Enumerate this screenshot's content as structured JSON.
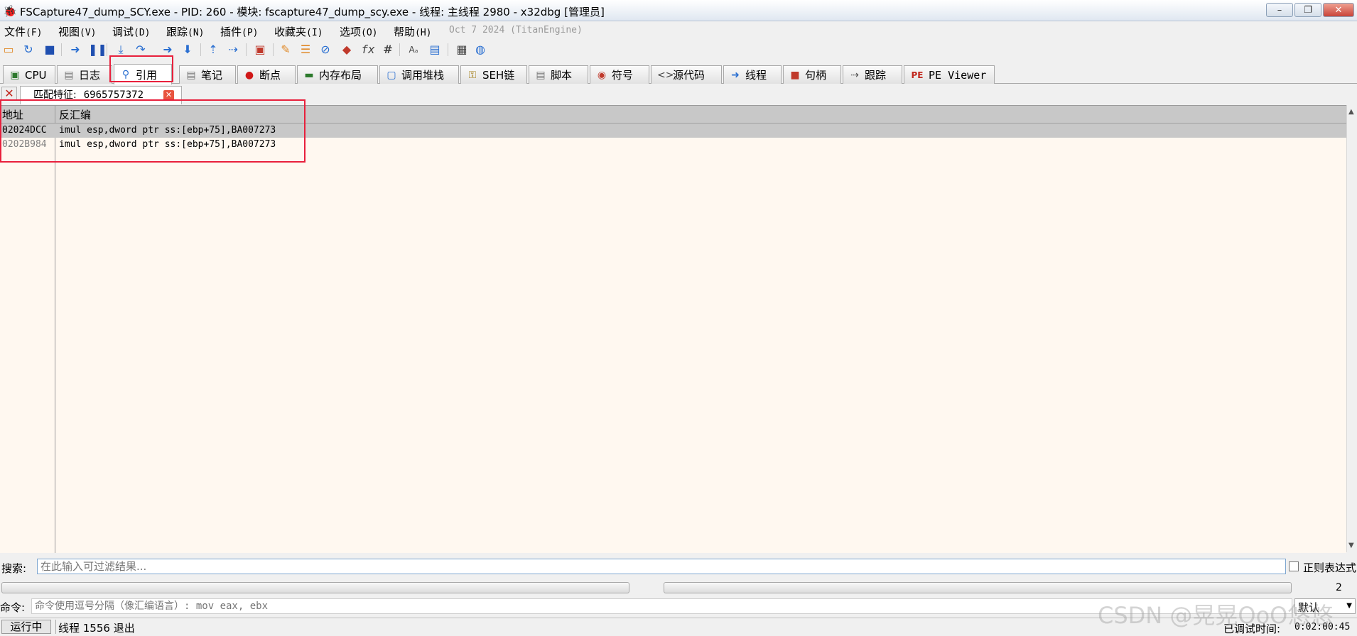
{
  "window": {
    "title": "FSCapture47_dump_SCY.exe - PID: 260 - 模块: fscapture47_dump_scy.exe - 线程: 主线程 2980 - x32dbg [管理员]",
    "app_icon": "bug-icon",
    "controls": {
      "minimize": "–",
      "restore": "❐",
      "close": "✕"
    }
  },
  "menu": {
    "items": [
      {
        "label": "文件",
        "key": "(F)"
      },
      {
        "label": "视图",
        "key": "(V)"
      },
      {
        "label": "调试",
        "key": "(D)"
      },
      {
        "label": "跟踪",
        "key": "(N)"
      },
      {
        "label": "插件",
        "key": "(P)"
      },
      {
        "label": "收藏夹",
        "key": "(I)"
      },
      {
        "label": "选项",
        "key": "(O)"
      },
      {
        "label": "帮助",
        "key": "(H)"
      }
    ],
    "version": "Oct 7 2024 (TitanEngine)"
  },
  "toolbar": {
    "buttons": [
      "open-icon",
      "restart-icon",
      "stop-icon",
      "run-icon",
      "pause-icon",
      "step-into-icon",
      "step-over-icon",
      "trace-into-icon",
      "trace-over-icon",
      "execute-till-return-icon",
      "run-to-user-code-icon",
      "scylla-icon",
      "patch-icon",
      "comments-icon",
      "labels-icon",
      "bookmarks-icon",
      "functions-icon",
      "hash-icon",
      "strings-icon",
      "calculator-icon",
      "settings-icon",
      "globe-icon"
    ],
    "fx_label": "fx",
    "hash_label": "#"
  },
  "tabs": [
    {
      "label": "CPU",
      "icon": "cpu-icon",
      "active": false
    },
    {
      "label": "日志",
      "icon": "log-icon",
      "active": false
    },
    {
      "label": "引用",
      "icon": "search-icon",
      "active": true
    },
    {
      "label": "笔记",
      "icon": "notes-icon",
      "active": false
    },
    {
      "label": "断点",
      "icon": "breakpoint-icon",
      "active": false
    },
    {
      "label": "内存布局",
      "icon": "memory-icon",
      "active": false
    },
    {
      "label": "调用堆栈",
      "icon": "call-stack-icon",
      "active": false
    },
    {
      "label": "SEH链",
      "icon": "seh-icon",
      "active": false
    },
    {
      "label": "脚本",
      "icon": "script-icon",
      "active": false
    },
    {
      "label": "符号",
      "icon": "symbols-icon",
      "active": false
    },
    {
      "label": "源代码",
      "icon": "source-icon",
      "active": false
    },
    {
      "label": "线程",
      "icon": "threads-icon",
      "active": false
    },
    {
      "label": "句柄",
      "icon": "handles-icon",
      "active": false
    },
    {
      "label": "跟踪",
      "icon": "trace-icon",
      "active": false
    },
    {
      "label": "PE Viewer",
      "icon": "pe-icon",
      "active": false
    }
  ],
  "subtab": {
    "label": "匹配特征:",
    "value": "6965757372"
  },
  "table": {
    "columns": [
      "地址",
      "反汇编"
    ],
    "rows": [
      {
        "address": "02024DCC",
        "disasm": "imul esp,dword ptr ss:[ebp+75],BA007273",
        "selected": true
      },
      {
        "address": "0202B984",
        "disasm": "imul esp,dword ptr ss:[ebp+75],BA007273",
        "selected": false
      }
    ]
  },
  "search": {
    "label": "搜索:",
    "placeholder": "在此输入可过滤结果...",
    "regex_label": "正则表达式",
    "result_count": "2"
  },
  "command": {
    "label": "命令:",
    "placeholder": "命令使用逗号分隔（像汇编语言）: mov eax, ebx",
    "mode": "默认"
  },
  "status": {
    "state": "运行中",
    "message": "线程 1556 退出",
    "elapsed_label": "已调试时间:",
    "elapsed": "0:02:00:45"
  },
  "watermark": "CSDN @晃晃OoO悠悠",
  "colors": {
    "highlight_box": "#e8203c",
    "table_bg": "#fff8f0",
    "selected_row": "#c8c8c8"
  }
}
